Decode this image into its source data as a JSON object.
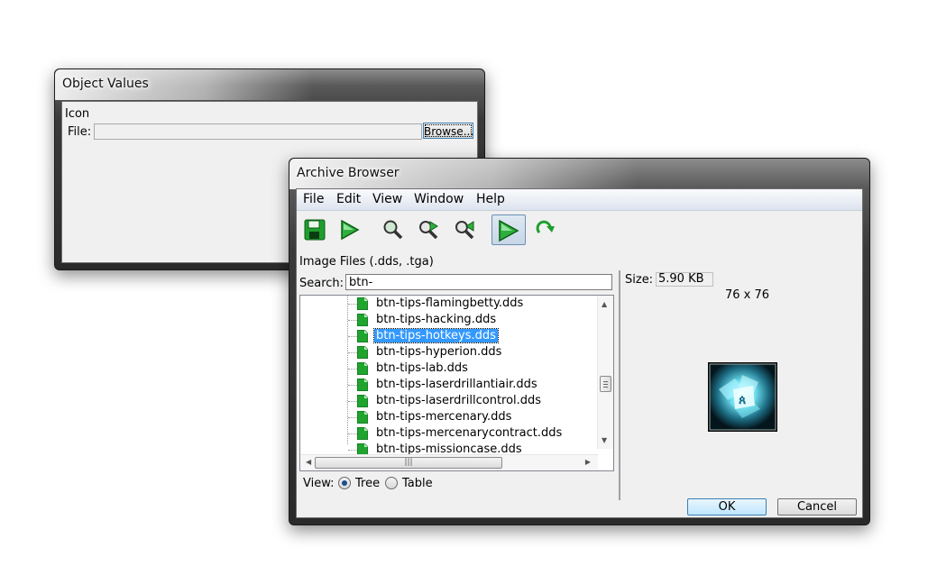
{
  "object_values": {
    "title": "Object Values",
    "icon_label": "Icon",
    "file_label": "File:",
    "file_value": "",
    "browse_label": "Browse..."
  },
  "archive_browser": {
    "title": "Archive Browser",
    "menu": [
      "File",
      "Edit",
      "View",
      "Window",
      "Help"
    ],
    "toolbar": [
      {
        "icon": "save-icon",
        "active": false
      },
      {
        "icon": "play-icon",
        "active": false
      },
      {
        "icon": "search-icon",
        "active": false
      },
      {
        "icon": "find-next-icon",
        "active": false
      },
      {
        "icon": "find-previous-icon",
        "active": false
      },
      {
        "icon": "play-toggle-icon",
        "active": true
      },
      {
        "icon": "refresh-icon",
        "active": false
      }
    ],
    "filter_label": "Image Files (.dds, .tga)",
    "search_label": "Search:",
    "search_value": "btn-",
    "files": [
      "btn-tips-flamingbetty.dds",
      "btn-tips-hacking.dds",
      "btn-tips-hotkeys.dds",
      "btn-tips-hyperion.dds",
      "btn-tips-lab.dds",
      "btn-tips-laserdrillantiair.dds",
      "btn-tips-laserdrillcontrol.dds",
      "btn-tips-mercenary.dds",
      "btn-tips-mercenarycontract.dds",
      "btn-tips-missioncase.dds"
    ],
    "selected_file": "btn-tips-hotkeys.dds",
    "view_label": "View:",
    "view_options": [
      "Tree",
      "Table"
    ],
    "view_selected": "Tree",
    "size_label": "Size:",
    "size_value": "5.90 KB",
    "dimensions": "76 x 76",
    "ok_label": "OK",
    "cancel_label": "Cancel"
  },
  "colors": {
    "selection": "#3399ff",
    "accent_green": "#1f9e2e",
    "window_chrome": "#2a2a2a"
  }
}
